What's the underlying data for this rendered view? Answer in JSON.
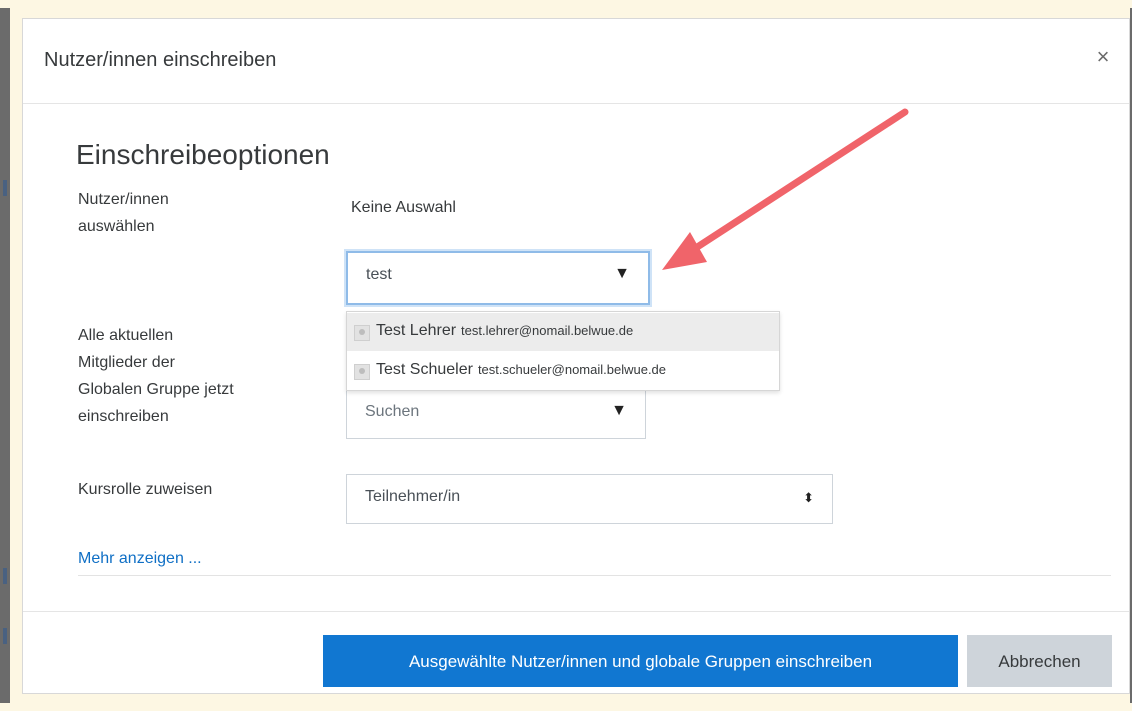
{
  "modal": {
    "title": "Nutzer/innen einschreiben",
    "close_label": "×"
  },
  "section_title": "Einschreibeoptionen",
  "select_users": {
    "label_line1": "Nutzer/innen",
    "label_line2": "auswählen",
    "selection_text": "Keine Auswahl",
    "search_value": "test",
    "caret": "▼"
  },
  "suggestions": [
    {
      "name": "Test Lehrer",
      "email": "test.lehrer@nomail.belwue.de",
      "highlighted": true
    },
    {
      "name": "Test Schueler",
      "email": "test.schueler@nomail.belwue.de",
      "highlighted": false
    }
  ],
  "global_group": {
    "label_lines": [
      "Alle aktuellen",
      "Mitglieder der",
      "Globalen Gruppe jetzt",
      "einschreiben"
    ],
    "placeholder": "Suchen",
    "caret": "▼"
  },
  "role": {
    "label": "Kursrolle zuweisen",
    "value": "Teilnehmer/in",
    "caret": "⬍"
  },
  "more_link": "Mehr anzeigen ...",
  "footer": {
    "primary_label": "Ausgewählte Nutzer/innen und globale Gruppen einschreiben",
    "cancel_label": "Abbrechen"
  },
  "colors": {
    "primary": "#1177d1",
    "link": "#0f6fc5",
    "annotation_arrow": "#f0646a"
  }
}
